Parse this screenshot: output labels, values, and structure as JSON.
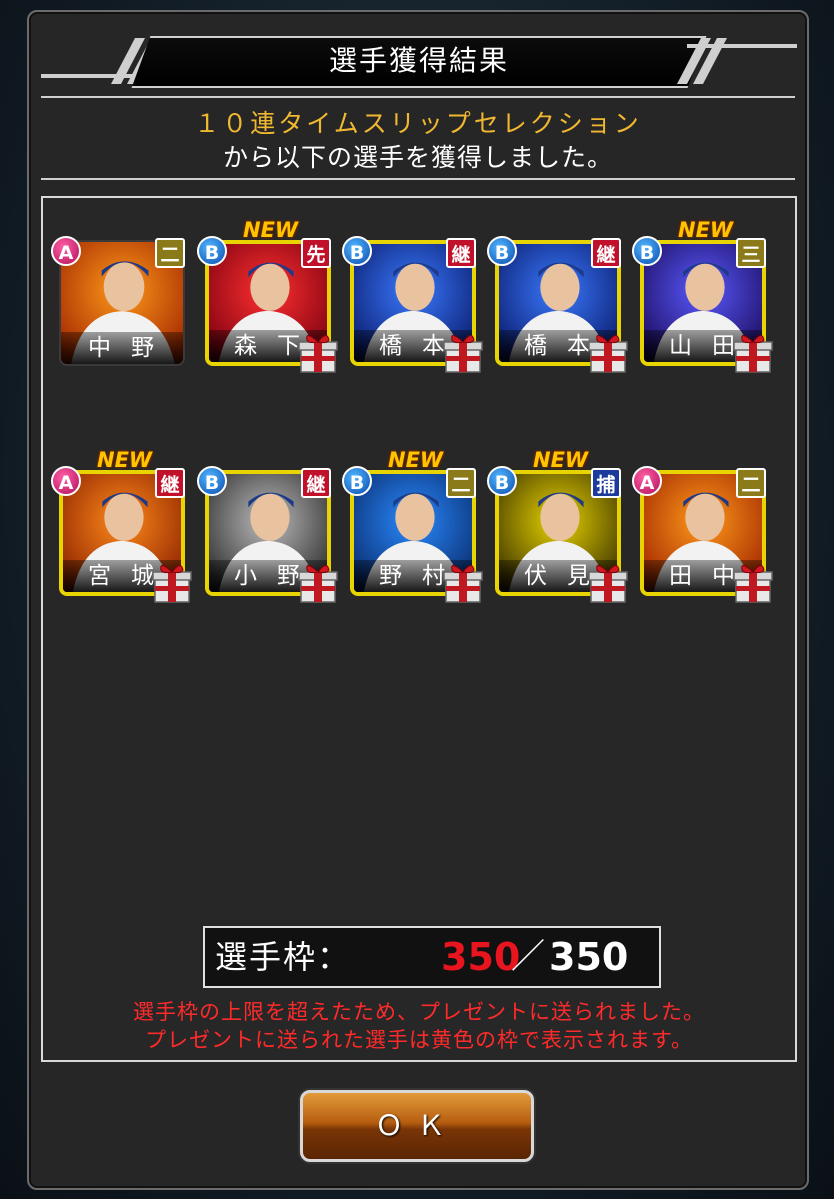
{
  "dialog": {
    "title": "選手獲得結果",
    "gacha_name": "１０連タイムスリップセレクション",
    "result_message": "から以下の選手を獲得しました。"
  },
  "players": [
    {
      "name": "中野",
      "rank": "A",
      "position": "二",
      "is_new": false,
      "sent_to_present": false
    },
    {
      "name": "森下",
      "rank": "B",
      "position": "先",
      "is_new": true,
      "sent_to_present": true
    },
    {
      "name": "橋本",
      "rank": "B",
      "position": "継",
      "is_new": false,
      "sent_to_present": true
    },
    {
      "name": "橋本",
      "rank": "B",
      "position": "継",
      "is_new": false,
      "sent_to_present": true
    },
    {
      "name": "山田",
      "rank": "B",
      "position": "三",
      "is_new": true,
      "sent_to_present": true
    },
    {
      "name": "宮城",
      "rank": "A",
      "position": "継",
      "is_new": true,
      "sent_to_present": true
    },
    {
      "name": "小野",
      "rank": "B",
      "position": "継",
      "is_new": false,
      "sent_to_present": true
    },
    {
      "name": "野村",
      "rank": "B",
      "position": "二",
      "is_new": true,
      "sent_to_present": true
    },
    {
      "name": "伏見",
      "rank": "B",
      "position": "捕",
      "is_new": true,
      "sent_to_present": true
    },
    {
      "name": "田中",
      "rank": "A",
      "position": "二",
      "is_new": false,
      "sent_to_present": true
    }
  ],
  "new_label": "NEW",
  "roster_capacity": {
    "label": "選手枠：",
    "current": "350",
    "separator": "／",
    "max": "350"
  },
  "warnings": [
    "選手枠の上限を超えたため、プレゼントに送られました。",
    "プレゼントに送られた選手は黄色の枠で表示されます。"
  ],
  "ok_button": "ＯＫ",
  "colors": {
    "gacha_name": "#f0b830",
    "warning": "#ff2a2a",
    "present_frame": "#e8d400",
    "current_count": "#e8141e"
  }
}
